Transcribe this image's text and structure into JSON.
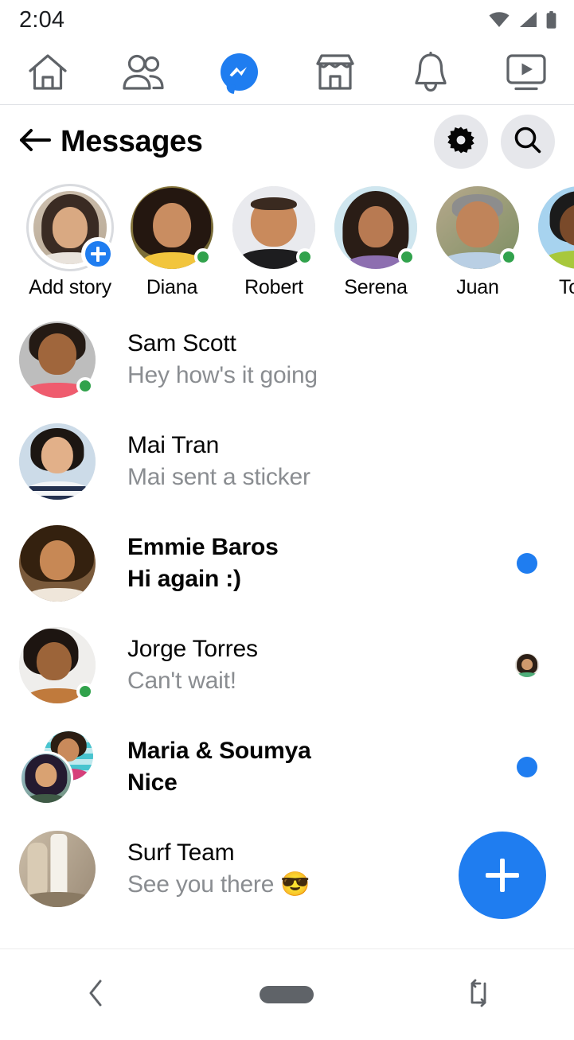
{
  "status_bar": {
    "time": "2:04",
    "icons": [
      "wifi-icon",
      "cellular-signal-icon",
      "battery-icon"
    ]
  },
  "top_tabs": [
    {
      "name": "home-tab",
      "icon": "home-icon",
      "active": false
    },
    {
      "name": "friends-tab",
      "icon": "friends-icon",
      "active": false
    },
    {
      "name": "messenger-tab",
      "icon": "messenger-icon",
      "active": true
    },
    {
      "name": "marketplace-tab",
      "icon": "marketplace-store-icon",
      "active": false
    },
    {
      "name": "notifications-tab",
      "icon": "bell-icon",
      "active": false
    },
    {
      "name": "watch-tab",
      "icon": "watch-play-icon",
      "active": false
    }
  ],
  "header": {
    "back_icon": "arrow-left-icon",
    "title": "Messages",
    "settings_icon": "gear-icon",
    "search_icon": "search-icon"
  },
  "stories": [
    {
      "label": "Add story",
      "add_story": true,
      "online": false,
      "ring": true
    },
    {
      "label": "Diana",
      "add_story": false,
      "online": true,
      "ring": false
    },
    {
      "label": "Robert",
      "add_story": false,
      "online": true,
      "ring": false
    },
    {
      "label": "Serena",
      "add_story": false,
      "online": true,
      "ring": false
    },
    {
      "label": "Juan",
      "add_story": false,
      "online": true,
      "ring": false
    },
    {
      "label": "Tony",
      "add_story": false,
      "online": false,
      "ring": false
    }
  ],
  "conversations": [
    {
      "name": "Sam Scott",
      "snippet": "Hey how's it going",
      "unread": false,
      "online": true,
      "right_indicator": "none",
      "group": false
    },
    {
      "name": "Mai Tran",
      "snippet": "Mai sent a sticker",
      "unread": false,
      "online": false,
      "right_indicator": "none",
      "group": false
    },
    {
      "name": "Emmie Baros",
      "snippet": "Hi again :)",
      "unread": true,
      "online": false,
      "right_indicator": "unread-dot",
      "group": false
    },
    {
      "name": "Jorge Torres",
      "snippet": "Can't wait!",
      "unread": false,
      "online": true,
      "right_indicator": "seen-avatar",
      "group": false
    },
    {
      "name": "Maria & Soumya",
      "snippet": "Nice",
      "unread": true,
      "online": false,
      "right_indicator": "unread-dot",
      "group": true
    },
    {
      "name": "Surf Team",
      "snippet": "See you there 😎",
      "unread": false,
      "online": false,
      "right_indicator": "none",
      "group": false
    }
  ],
  "fab": {
    "label": "+",
    "name": "new-message-button"
  },
  "bottom_nav": [
    {
      "name": "android-back-button",
      "icon": "chevron-left-icon"
    },
    {
      "name": "android-home-button",
      "icon": "home-pill-icon"
    },
    {
      "name": "android-rotate-button",
      "icon": "rotate-screen-icon"
    }
  ],
  "colors": {
    "brand_blue": "#1f7df0",
    "online_green": "#31a24c",
    "text_primary": "#050505",
    "text_secondary": "#8a8d91",
    "icon_button_bg": "#e6e7eb"
  }
}
